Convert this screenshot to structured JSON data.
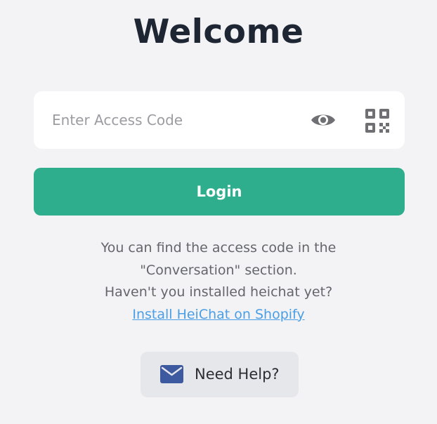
{
  "header": {
    "title": "Welcome"
  },
  "access_code": {
    "value": "",
    "placeholder": "Enter Access Code",
    "visibility_icon": "eye-icon",
    "scan_icon": "qr-code-icon"
  },
  "login": {
    "label": "Login",
    "color": "#2fae8d"
  },
  "info": {
    "line1": "You can find the access code in the",
    "line2": "\"Conversation\" section.",
    "line3": "Haven't you installed heichat yet?",
    "install_link": "Install HeiChat on Shopify",
    "link_color": "#4a9ee6"
  },
  "help": {
    "label": "Need Help?",
    "icon": "mail-icon",
    "icon_color": "#3d5aa0"
  }
}
